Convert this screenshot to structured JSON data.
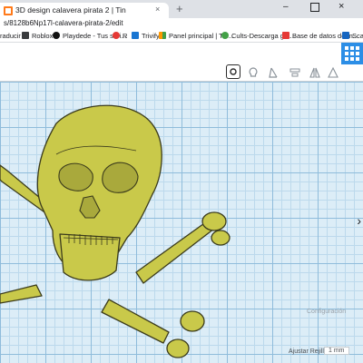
{
  "browser": {
    "tab_title": "3D design calavera pirata 2 | Tin",
    "tab_close": "×",
    "new_tab": "+",
    "url_visible": "s/8128b6Np17l-calavera-pirata-2/edit",
    "window_minimize": "–",
    "window_close": "×"
  },
  "bookmarks": [
    {
      "label": "raducir",
      "icon_color": "#4285f4"
    },
    {
      "label": "Roblox",
      "icon_color": "#393b3d"
    },
    {
      "label": "Playdede - Tus seri...",
      "icon_color": "#111111"
    },
    {
      "label": "R",
      "icon_color": "#e53935"
    },
    {
      "label": "Trivify",
      "icon_color": "#1976d2"
    },
    {
      "label": "Panel principal | Tin...",
      "icon_color": "#ff9800"
    },
    {
      "label": "Cults-Descarga gra...",
      "icon_color": "#43a047"
    },
    {
      "label": "Base de datos de m...",
      "icon_color": "#e53935"
    },
    {
      "label": "Scan",
      "icon_color": "#1565c0"
    }
  ],
  "toolbar": {
    "tools": [
      "note-icon",
      "bulb-icon",
      "ruler-icon",
      "align-icon",
      "mirror-icon",
      "flip-icon",
      "group-icon"
    ],
    "accent_color": "#2c8ee6"
  },
  "workplane": {
    "object_color": "#c9c94a",
    "config_label": "Configuración",
    "snap_label": "Ajustar Rejilla",
    "snap_value": "1 mm",
    "nav_arrow": "›"
  }
}
